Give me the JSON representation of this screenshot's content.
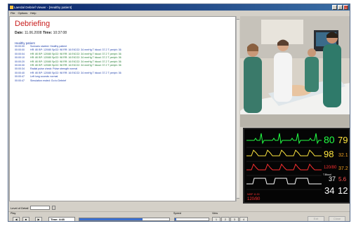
{
  "window": {
    "title": "Laerdal Debrief Viewer - [Healthy patient]",
    "controls": [
      "_",
      "□",
      "×"
    ]
  },
  "menu": [
    "File",
    "Options",
    "Help"
  ],
  "debrief": {
    "title": "Debriefing",
    "date_label": "Date:",
    "date_value": "11.06.2008",
    "time_label": "Time:",
    "time_value": "10:37:08"
  },
  "log": {
    "section": "Healthy patient",
    "rows": [
      {
        "time": "00:00:00",
        "text": "Scenario started: Healthy patient",
        "green": false
      },
      {
        "time": "00:00:00",
        "text": "HR: 80 BP: 120/80 SpO2: 98 RR: 16 EtCO2: 34 mmHg T blood: 37.2 T periph: 36",
        "green": false
      },
      {
        "time": "00:00:04",
        "text": "HR: 80 BP: 120/80 SpO2: 98 RR: 16 EtCO2: 34 mmHg T blood: 37.2 T periph: 36",
        "green": true
      },
      {
        "time": "00:00:10",
        "text": "HR: 80 BP: 120/80 SpO2: 98 RR: 16 EtCO2: 34 mmHg T blood: 37.2 T periph: 36",
        "green": true
      },
      {
        "time": "00:00:20",
        "text": "HR: 80 BP: 120/80 SpO2: 98 RR: 16 EtCO2: 34 mmHg T blood: 37.2 T periph: 36",
        "green": true
      },
      {
        "time": "00:00:30",
        "text": "HR: 80 BP: 120/80 SpO2: 98 RR: 16 EtCO2: 34 mmHg T blood: 37.2 T periph: 36",
        "green": true
      },
      {
        "time": "00:00:34",
        "text": "Radial pulse check: Pulse strength normal",
        "green": false
      },
      {
        "time": "00:00:40",
        "text": "HR: 80 BP: 120/80 SpO2: 98 RR: 16 EtCO2: 34 mmHg T blood: 37.2 T periph: 36",
        "green": false
      },
      {
        "time": "00:00:47",
        "text": "Left lung sounds: normal",
        "green": false
      },
      {
        "time": "00:00:47",
        "text": "Simulation ended: Go to Debrief",
        "green": false
      }
    ]
  },
  "monitor": {
    "hr": "80",
    "hr2": "79",
    "spo2": "98",
    "spo2_sub": "32.1",
    "abp": "120/80",
    "abp_sub": "37.2",
    "temp_label": "T.Blood",
    "temp": "37",
    "temp_sub": "5.6",
    "etco2": "34",
    "rr": "12",
    "nibp_label": "NIBP 11:30",
    "nibp": "120/80",
    "colors": {
      "hr": "#22ff44",
      "spo2": "#ffe640",
      "abp": "#ff3030",
      "etco2": "#ffffff",
      "aux": "#f0a020"
    }
  },
  "controls": {
    "level_of_detail_label": "Level of Detail",
    "play_label": "Play",
    "time_field": "Time: 4:48",
    "speed_label": "Speed",
    "view_label": "View",
    "progress": 0.7,
    "speed": 0.05,
    "buttons": [
      "◀",
      "■",
      "▶"
    ],
    "view_buttons": [
      "1",
      "2",
      "3",
      "4"
    ],
    "exit_label": "Exit",
    "close_label": "Close"
  }
}
